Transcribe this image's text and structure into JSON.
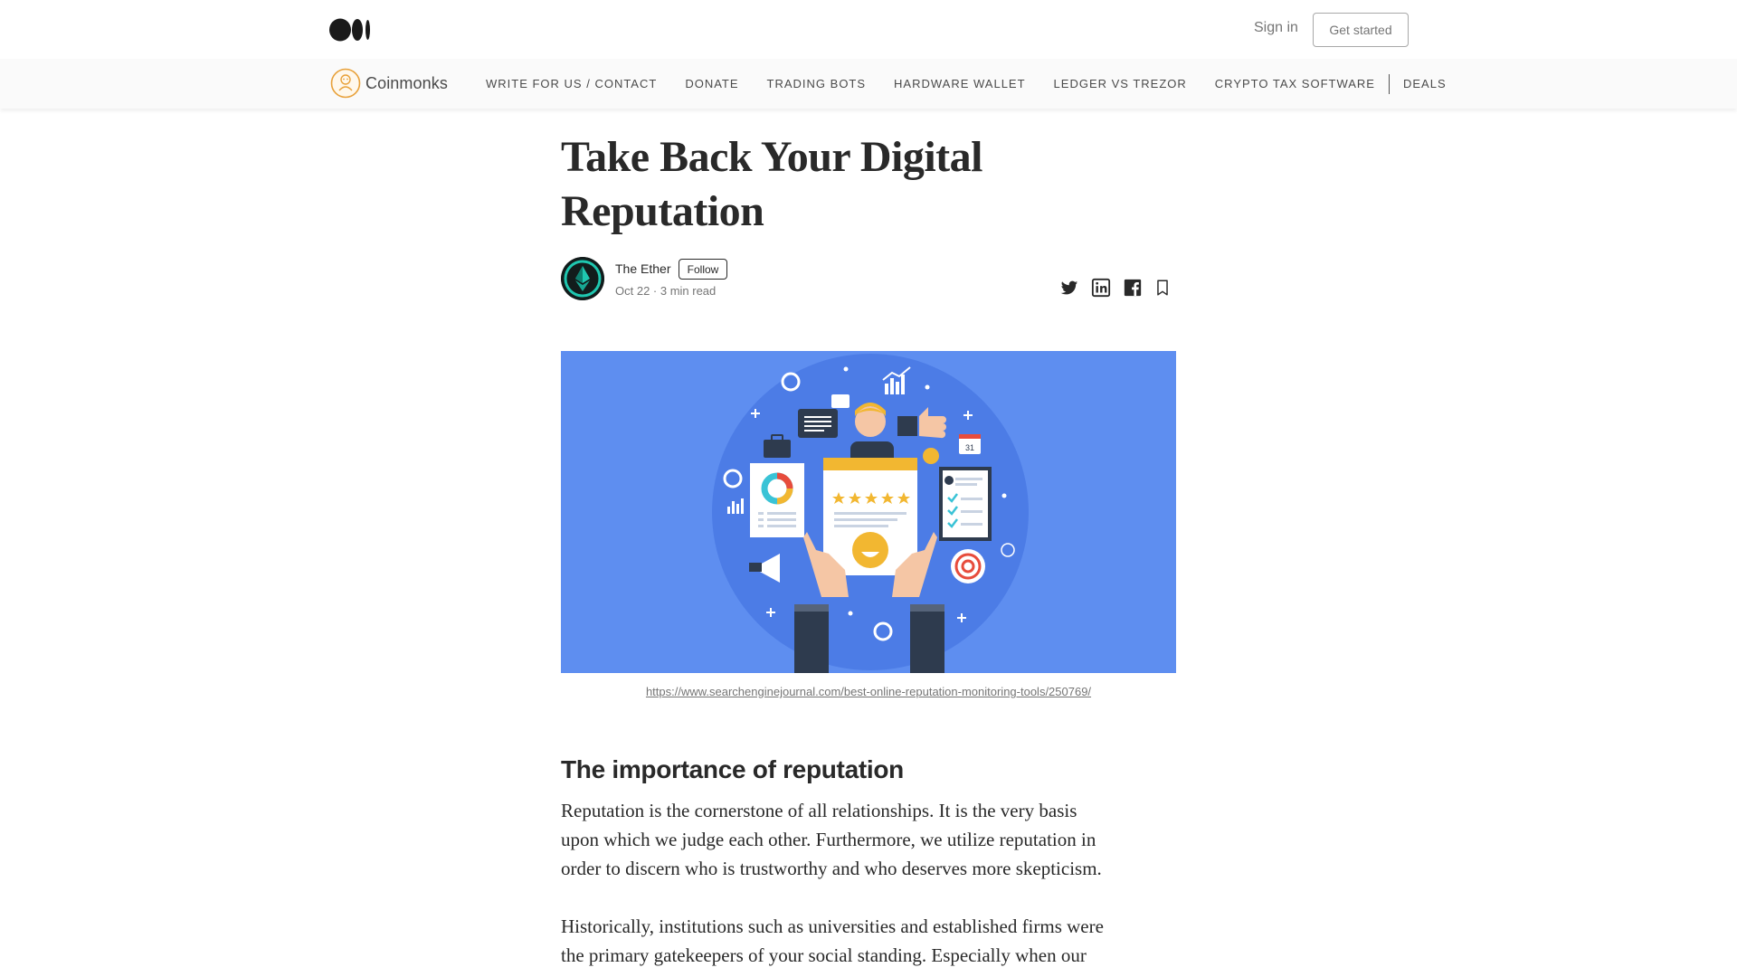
{
  "topbar": {
    "logo_icon": "medium-logo-icon",
    "signin_label": "Sign in",
    "get_started_label": "Get started"
  },
  "publication": {
    "name": "Coinmonks",
    "logo_icon": "coinmonks-logo-icon",
    "accent": "#e8a13a",
    "nav": [
      {
        "label": "WRITE FOR US / CONTACT"
      },
      {
        "label": "DONATE"
      },
      {
        "label": "TRADING BOTS"
      },
      {
        "label": "HARDWARE WALLET"
      },
      {
        "label": "LEDGER VS TREZOR"
      },
      {
        "label": "CRYPTO TAX SOFTWARE"
      },
      {
        "label": "DEALS"
      }
    ]
  },
  "article": {
    "title_line1": "Take Back Your Digital",
    "title_line2": "Reputation",
    "author": "The Ether",
    "follow_label": "Follow",
    "meta": "Oct 22 · 3 min read",
    "share_icons": [
      "twitter-icon",
      "linkedin-icon",
      "facebook-icon",
      "bookmark-icon"
    ],
    "hero_background": "#5e8ef0",
    "hero_calendar_day": "31",
    "caption": "https://www.searchenginejournal.com/best-online-reputation-monitoring-tools/250769/",
    "heading": "The importance of reputation",
    "para1_line1": "Reputation is the cornerstone of all relationships. It is the very basis",
    "para1_line2": "upon which we judge each other. Furthermore, we utilize reputation in",
    "para1_line3": "order to discern who is trustworthy and who deserves more skepticism.",
    "para2_line1": "Historically, institutions such as universities and established firms were",
    "para2_line2": "the primary gatekeepers of your social standing. Especially when our"
  }
}
